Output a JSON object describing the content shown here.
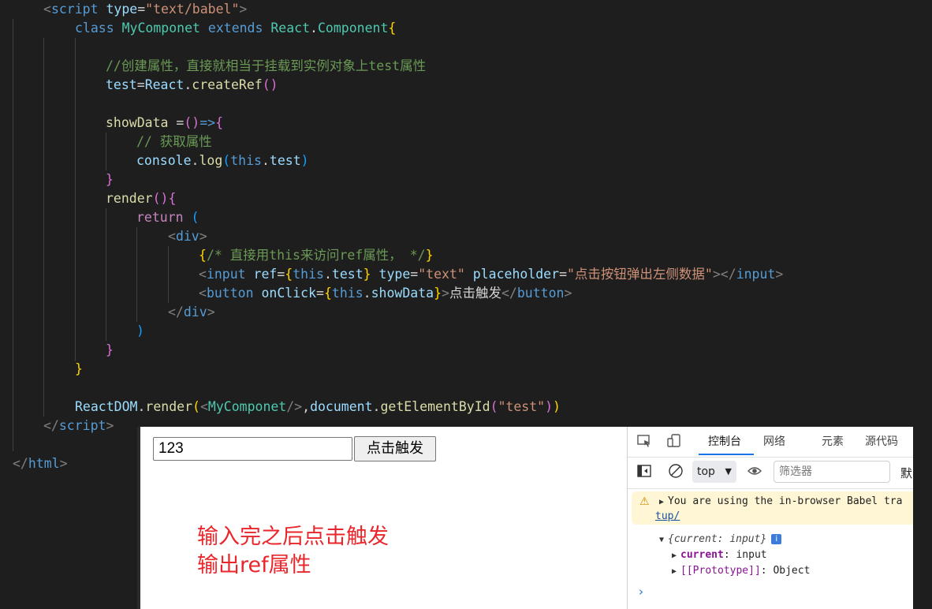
{
  "code": {
    "l1": {
      "open": "<",
      "tag": "script",
      "attr": "type",
      "eq": "=",
      "str": "\"text/babel\"",
      "close": ">"
    },
    "l2": {
      "kw1": "class",
      "name": "MyComponet",
      "kw2": "extends",
      "cls": "React",
      "dot": ".",
      "cls2": "Component",
      "brace": "{"
    },
    "l3": {
      "comment": "//创建属性，直接就相当于挂载到实例对象上test属性"
    },
    "l4": {
      "var": "test",
      "eq": "=",
      "obj": "React",
      "dot": ".",
      "fn": "createRef",
      "parens": "()"
    },
    "l5": {
      "var": "showData",
      "eq": " =",
      "parens": "()",
      "arrow": "=>",
      "brace": "{"
    },
    "l6": {
      "comment": "// 获取属性"
    },
    "l7": {
      "obj": "console",
      "dot": ".",
      "fn": "log",
      "po": "(",
      "this": "this",
      "dot2": ".",
      "prop": "test",
      "pc": ")"
    },
    "l8": {
      "brace": "}"
    },
    "l9": {
      "fn": "render",
      "parens": "()",
      "brace": "{"
    },
    "l10": {
      "kw": "return",
      "paren": "("
    },
    "l11": {
      "open": "<",
      "tag": "div",
      "close": ">"
    },
    "l12": {
      "bo": "{",
      "comment": "/* 直接用this来访问ref属性， */",
      "bc": "}"
    },
    "l13": {
      "open": "<",
      "tag": "input",
      "attr1": "ref",
      "eq1": "=",
      "bo": "{",
      "this": "this",
      "dot": ".",
      "prop": "test",
      "bc": "}",
      "attr2": "type",
      "eq2": "=",
      "str2": "\"text\"",
      "attr3": "placeholder",
      "eq3": "=",
      "str3": "\"点击按钮弹出左侧数据\"",
      "close": "></",
      "tag2": "input",
      "close2": ">"
    },
    "l14": {
      "open": "<",
      "tag": "button",
      "attr": "onClick",
      "eq": "=",
      "bo": "{",
      "this": "this",
      "dot": ".",
      "prop": "showData",
      "bc": "}",
      "gt": ">",
      "text": "点击触发",
      "open2": "</",
      "tag2": "button",
      "close2": ">"
    },
    "l15": {
      "open": "</",
      "tag": "div",
      "close": ">"
    },
    "l16": {
      "paren": ")"
    },
    "l17": {
      "brace": "}"
    },
    "l18": {
      "brace": "}"
    },
    "l19": {
      "obj": "ReactDOM",
      "dot": ".",
      "fn": "render",
      "po": "(",
      "lt": "<",
      "comp": "MyComponet",
      "sc": "/>",
      "comma": ",",
      "doc": "document",
      "dot2": ".",
      "fn2": "getElementById",
      "po2": "(",
      "str": "\"test\"",
      "pc2": ")",
      "pc": ")"
    },
    "l20": {
      "open": "</",
      "tag": "script",
      "close": ">"
    },
    "l21": {
      "open": "</",
      "tag": "html",
      "close": ">"
    }
  },
  "preview": {
    "input_value": "123",
    "button_label": "点击触发",
    "annotation_line1": "输入完之后点击触发",
    "annotation_line2": "输出ref属性"
  },
  "devtools": {
    "tabs": [
      "控制台",
      "网络",
      "元素",
      "源代码"
    ],
    "context": "top",
    "filter_placeholder": "筛选器",
    "more_label": "默",
    "warning_text": "You are using the in-browser Babel tra",
    "warning_link": "tup/",
    "log_summary_open": "{",
    "log_summary_key": "current",
    "log_summary_sep": ": ",
    "log_summary_val": "input",
    "log_summary_close": "}",
    "info_badge": "i",
    "prop1_key": "current",
    "prop1_sep": ": ",
    "prop1_val": "input",
    "prop2_key": "[[Prototype]]",
    "prop2_sep": ": ",
    "prop2_val": "Object",
    "prompt": "›"
  },
  "colors": {
    "editor_bg": "#1e1e1e",
    "comment": "#6a9955",
    "keyword": "#569cd6",
    "string": "#ce9178",
    "annotation": "#e8262b"
  }
}
